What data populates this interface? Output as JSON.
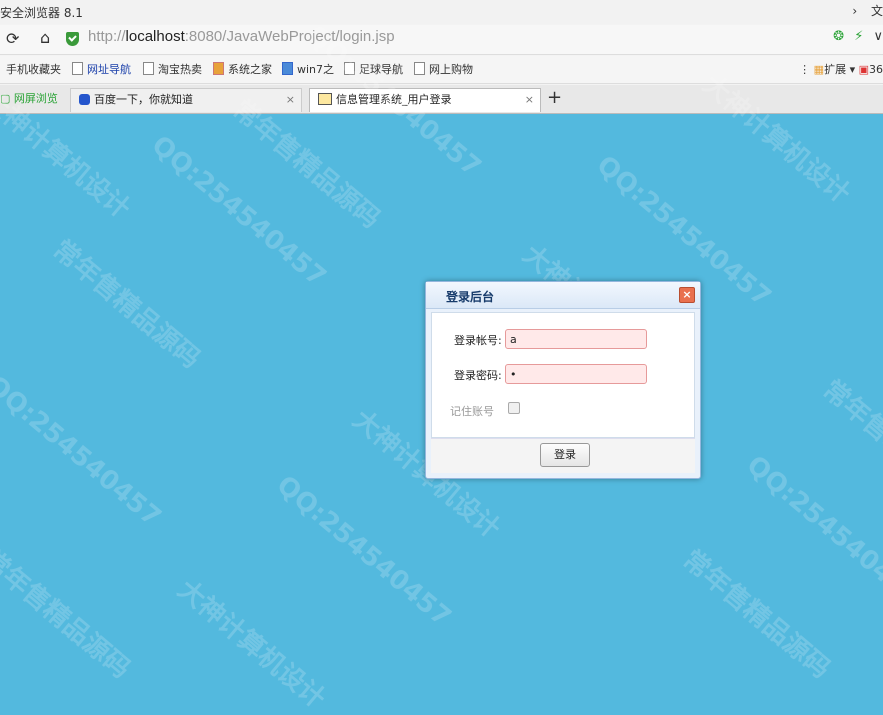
{
  "window": {
    "title": "安全浏览器 8.1",
    "controls": [
      "›",
      "文"
    ]
  },
  "nav": {
    "url_prefix": "http://",
    "url_host": "localhost",
    "url_rest": ":8080/JavaWebProject/login.jsp",
    "right_icons": [
      "❂",
      "⚡",
      "∨"
    ]
  },
  "bookmarks": {
    "items": [
      "手机收藏夹",
      "网址导航",
      "淘宝热卖",
      "系统之家",
      "win7之",
      "足球导航",
      "网上购物"
    ],
    "extension": "扩展",
    "extension_extra": "36"
  },
  "tabs": [
    {
      "label": "网屏浏览"
    },
    {
      "label": "百度一下，你就知道"
    },
    {
      "label": "信息管理系统_用户登录"
    }
  ],
  "tab_close": "×",
  "tab_new": "+",
  "watermarks": [
    "QQ:254540457",
    "常年售精品源码",
    "大神计算机设计"
  ],
  "dialog": {
    "title": "登录后台",
    "close": "×",
    "account_label": "登录帐号:",
    "account_value": "a",
    "password_label": "登录密码:",
    "password_value": "•",
    "remember_label": "记住账号",
    "login_button": "登录"
  },
  "colors": {
    "background": "#53b9de",
    "dialog_header": "#dbe8f7",
    "input_error": "#ffe9e9"
  }
}
